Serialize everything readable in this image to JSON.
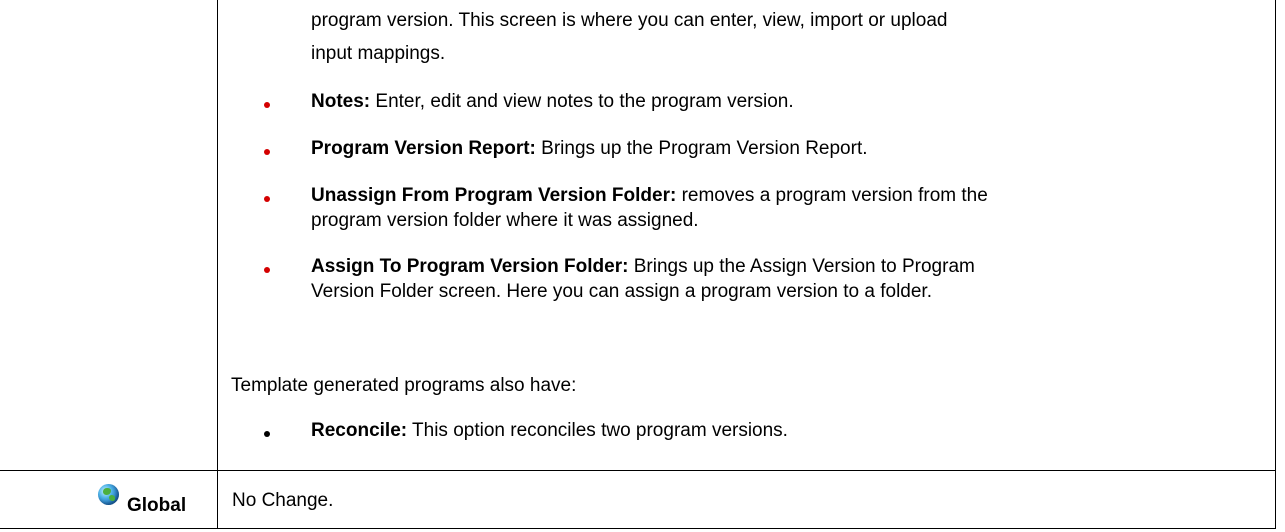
{
  "content": {
    "intro_line1": "program version. This screen is where you can enter, view, import or upload",
    "intro_line2": "input mappings.",
    "bullets": [
      {
        "term": "Notes:",
        "line1": " Enter, edit and view notes to the program version.",
        "line2": ""
      },
      {
        "term": "Program Version Report:",
        "line1": " Brings up the Program Version Report.",
        "line2": ""
      },
      {
        "term": "Unassign From Program Version Folder:",
        "line1": " removes a program version from the",
        "line2": "program version folder where it was assigned."
      },
      {
        "term": "Assign To Program Version Folder:",
        "line1": " Brings up the Assign Version to Program",
        "line2": "Version Folder screen. Here you can assign a program version to a folder."
      }
    ],
    "template_intro": "Template generated programs also have:",
    "template_bullet": {
      "term": "Reconcile:",
      "text": " This option reconciles two program versions."
    }
  },
  "global_row": {
    "icon": "globe-icon",
    "label": "Global",
    "value": "No Change."
  },
  "colors": {
    "bullet_red": "#d40000",
    "bullet_black": "#000000"
  }
}
